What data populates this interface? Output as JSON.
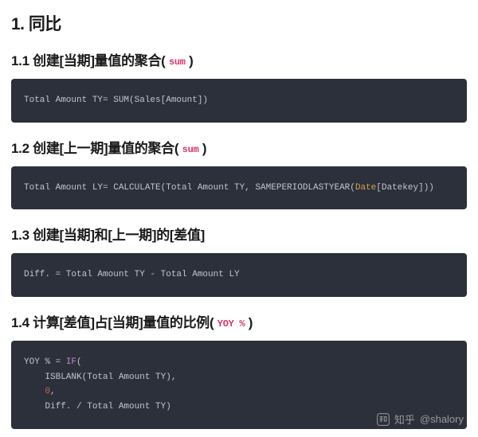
{
  "h1": "1. 同比",
  "sections": [
    {
      "heading_pre": "1.1 创建[当期]量值的聚合( ",
      "heading_badge": "sum",
      "heading_post": " )",
      "code_plain": "Total Amount TY= SUM(Sales[Amount])"
    },
    {
      "heading_pre": "1.2 创建[上一期]量值的聚合( ",
      "heading_badge": "sum",
      "heading_post": " )",
      "code_html": "Total Amount LY= CALCULATE(Total Amount TY, SAMEPERIODLASTYEAR(<span class=\"id\">Date</span>[Datekey]))"
    },
    {
      "heading_pre": "1.3 创建[当期]和[上一期]的[差值]",
      "heading_badge": "",
      "heading_post": "",
      "code_plain": "Diff. = Total Amount TY - Total Amount LY"
    },
    {
      "heading_pre": "1.4 计算[差值]占[当期]量值的比例( ",
      "heading_badge": "YOY %",
      "heading_post": " )",
      "code_html": "YOY % = <span class=\"kw\">IF</span>(\n    ISBLANK(Total Amount TY),\n    <span class=\"num\">0</span>,\n    Diff. / Total Amount TY)"
    }
  ],
  "watermark": {
    "brand": "知乎",
    "handle": "@shalory"
  }
}
